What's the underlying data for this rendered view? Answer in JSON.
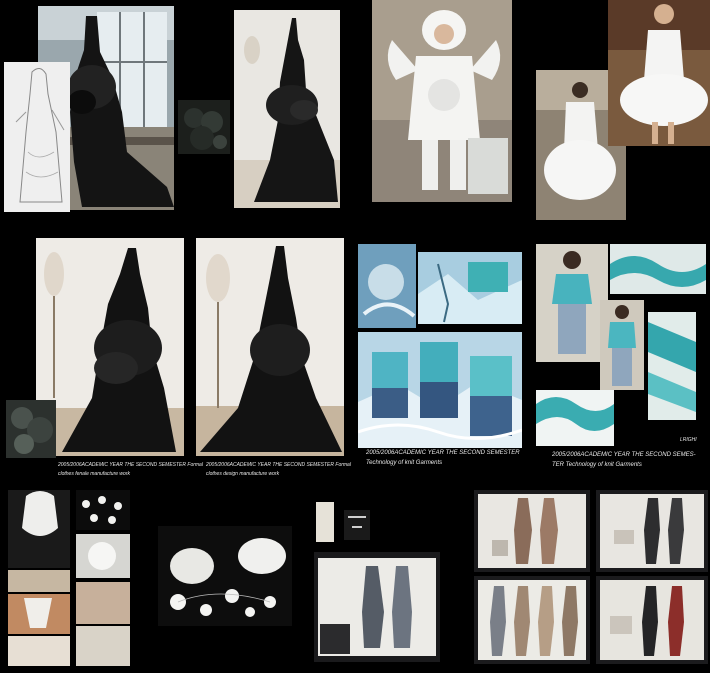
{
  "captions": {
    "sec4_line1": "2005/2006ACADEMIC YEAR  THE SECOND SEMESTER  Formal",
    "sec4_line2": "clothes fenale manufacture  work",
    "sec5_line1": "2005/2006ACADEMIC YEAR  THE SECOND SEMESTER  Formal",
    "sec5_line2": "clothes design manufacture  work",
    "sec6_line1": "2005/2006ACADEMIC YEAR  THE SECOND SEMESTER",
    "sec6_line2": "Technology of knit Garments",
    "sec7_line1": "2005/2006ACADEMIC YEAR  THE SECOND SEMES-",
    "sec7_line2": "TER  Technology of knit Garments",
    "sec7_tag": "LRIGHI"
  },
  "colors": {
    "background": "#000000",
    "room_wall": "#e7e2d8",
    "black_gown": "#161616",
    "white_costume": "#f4f4f2",
    "knit_teal": "#3fb0b4",
    "sky_blue": "#9fc6dd",
    "xray_white": "#ece9e4"
  }
}
